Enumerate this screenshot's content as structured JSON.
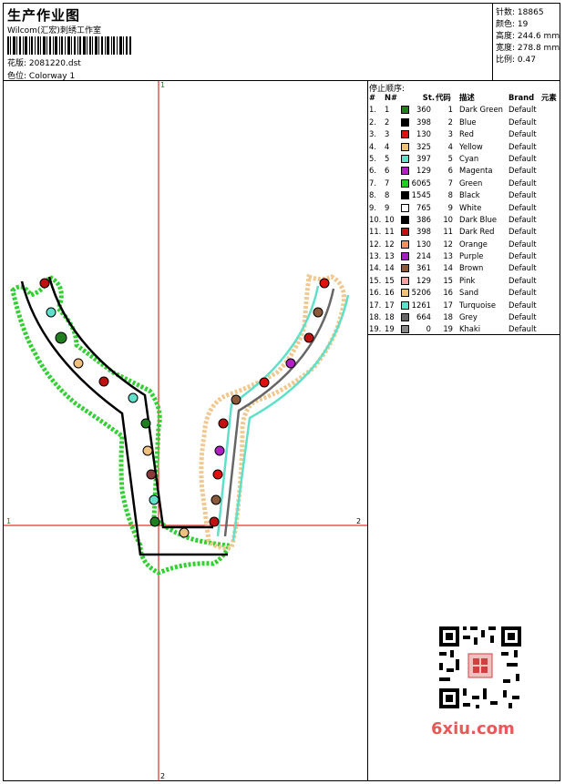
{
  "header": {
    "title": "生产作业图",
    "studio": "Wilcom(汇宏)刺绣工作室",
    "pattern_label": "花版:",
    "pattern_value": "2081220.dst",
    "colorway_label": "色位:",
    "colorway_value": "Colorway 1"
  },
  "stats": {
    "stitches_label": "针数:",
    "stitches_value": "18865",
    "colors_label": "颜色:",
    "colors_value": "19",
    "height_label": "高度:",
    "height_value": "244.6 mm",
    "width_label": "宽度:",
    "width_value": "278.8 mm",
    "scale_label": "比例:",
    "scale_value": "0.47"
  },
  "design": {
    "axis_labels": {
      "top": "1",
      "bottom": "2",
      "left": "1",
      "right": "2"
    },
    "axis_color": "#e00000"
  },
  "stop_sequence": {
    "title": "停止顺序:",
    "headers": {
      "idx": "#",
      "no": "N#",
      "st": "St.",
      "code": "代码",
      "desc": "描述",
      "brand": "Brand",
      "elem": "元素"
    },
    "rows": [
      {
        "idx": "1.",
        "no": "1",
        "color": "#1f7f1f",
        "st": "360",
        "code": "1",
        "desc": "Dark Green",
        "brand": "Default"
      },
      {
        "idx": "2.",
        "no": "2",
        "color": "#000000",
        "st": "398",
        "code": "2",
        "desc": "Blue",
        "brand": "Default"
      },
      {
        "idx": "3.",
        "no": "3",
        "color": "#e01010",
        "st": "130",
        "code": "3",
        "desc": "Red",
        "brand": "Default"
      },
      {
        "idx": "4.",
        "no": "4",
        "color": "#f0c080",
        "st": "325",
        "code": "4",
        "desc": "Yellow",
        "brand": "Default"
      },
      {
        "idx": "5.",
        "no": "5",
        "color": "#60e0c8",
        "st": "397",
        "code": "5",
        "desc": "Cyan",
        "brand": "Default"
      },
      {
        "idx": "6.",
        "no": "6",
        "color": "#b020c0",
        "st": "129",
        "code": "6",
        "desc": "Magenta",
        "brand": "Default"
      },
      {
        "idx": "7.",
        "no": "7",
        "color": "#20d020",
        "st": "6065",
        "code": "7",
        "desc": "Green",
        "brand": "Default"
      },
      {
        "idx": "8.",
        "no": "8",
        "color": "#000000",
        "st": "1545",
        "code": "8",
        "desc": "Black",
        "brand": "Default"
      },
      {
        "idx": "9.",
        "no": "9",
        "color": "#ffffff",
        "st": "765",
        "code": "9",
        "desc": "White",
        "brand": "Default"
      },
      {
        "idx": "10.",
        "no": "10",
        "color": "#000000",
        "st": "386",
        "code": "10",
        "desc": "Dark Blue",
        "brand": "Default"
      },
      {
        "idx": "11.",
        "no": "11",
        "color": "#c01010",
        "st": "398",
        "code": "11",
        "desc": "Dark Red",
        "brand": "Default"
      },
      {
        "idx": "12.",
        "no": "12",
        "color": "#f09060",
        "st": "130",
        "code": "12",
        "desc": "Orange",
        "brand": "Default"
      },
      {
        "idx": "13.",
        "no": "13",
        "color": "#a020c0",
        "st": "214",
        "code": "13",
        "desc": "Purple",
        "brand": "Default"
      },
      {
        "idx": "14.",
        "no": "14",
        "color": "#8a5a3a",
        "st": "361",
        "code": "14",
        "desc": "Brown",
        "brand": "Default"
      },
      {
        "idx": "15.",
        "no": "15",
        "color": "#f4a0a0",
        "st": "129",
        "code": "15",
        "desc": "Pink",
        "brand": "Default"
      },
      {
        "idx": "16.",
        "no": "16",
        "color": "#f0c080",
        "st": "5206",
        "code": "16",
        "desc": "Sand",
        "brand": "Default"
      },
      {
        "idx": "17.",
        "no": "17",
        "color": "#60e0c8",
        "st": "1261",
        "code": "17",
        "desc": "Turquoise",
        "brand": "Default"
      },
      {
        "idx": "18.",
        "no": "18",
        "color": "#666666",
        "st": "664",
        "code": "18",
        "desc": "Grey",
        "brand": "Default"
      },
      {
        "idx": "19.",
        "no": "19",
        "color": "#888888",
        "st": "0",
        "code": "19",
        "desc": "Khaki",
        "brand": "Default"
      }
    ]
  },
  "watermark": {
    "text": "6xiu.com",
    "qr_icon": "qr-code-icon"
  }
}
